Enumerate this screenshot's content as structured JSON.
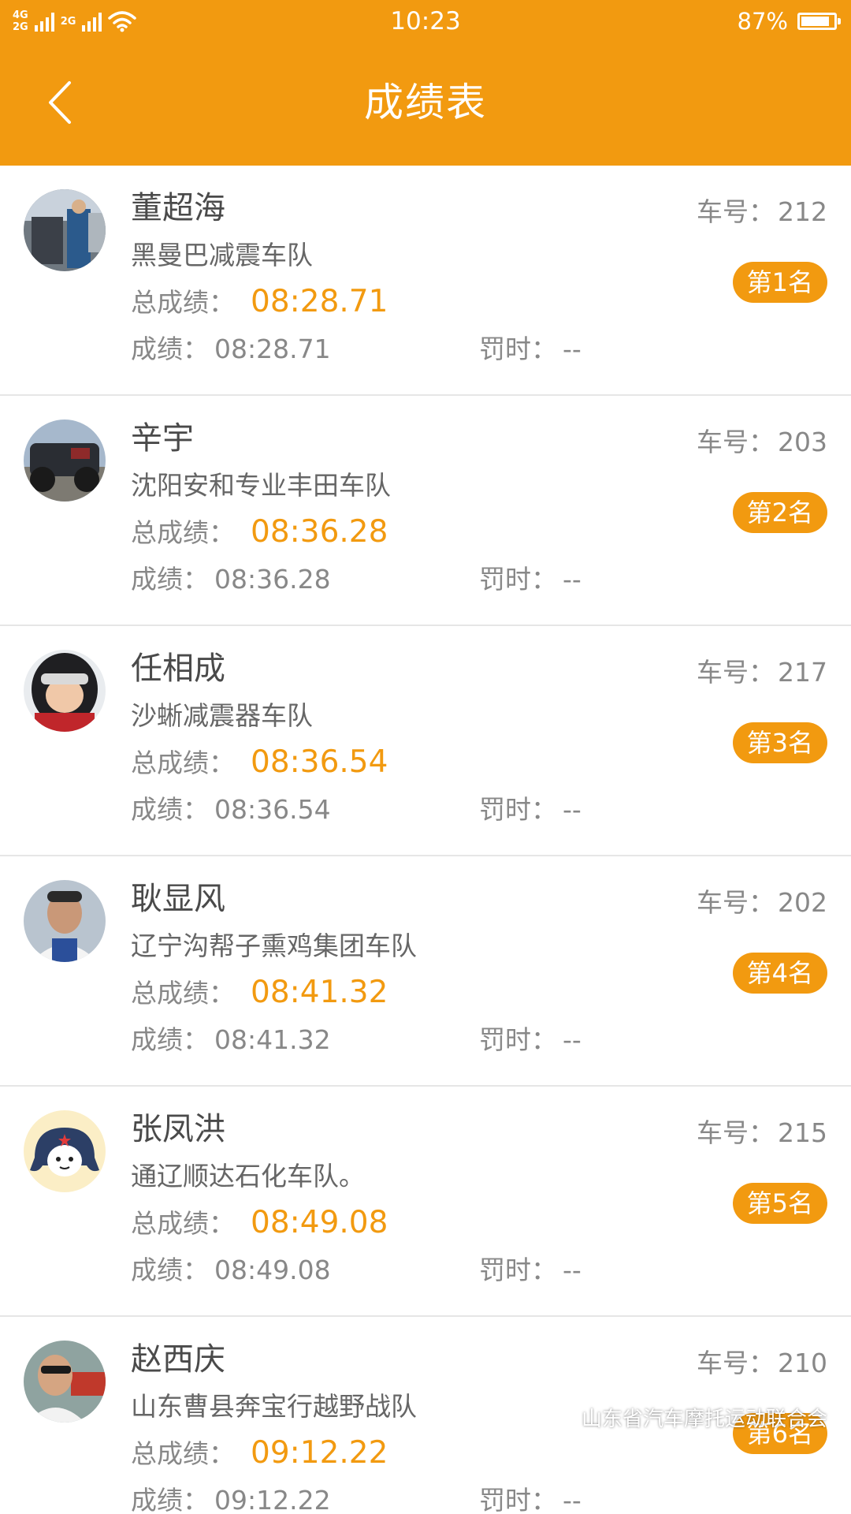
{
  "status_bar": {
    "network_top": "4G",
    "network_bottom": "2G",
    "network_extra": "2G",
    "time": "10:23",
    "battery": "87%",
    "battery_level": 0.87
  },
  "nav": {
    "title": "成绩表"
  },
  "labels": {
    "car_no": "车号：",
    "total": "总成绩：",
    "score": "成绩：",
    "penalty": "罚时："
  },
  "results": [
    {
      "name": "董超海",
      "team": "黑曼巴减震车队",
      "car_no": "212",
      "rank": "第1名",
      "total": "08:28.71",
      "score": "08:28.71",
      "penalty": "--",
      "avatar": "photo-avatar"
    },
    {
      "name": "辛宇",
      "team": "沈阳安和专业丰田车队",
      "car_no": "203",
      "rank": "第2名",
      "total": "08:36.28",
      "score": "08:36.28",
      "penalty": "--",
      "avatar": "photo-avatar"
    },
    {
      "name": "任相成",
      "team": "沙蜥减震器车队",
      "car_no": "217",
      "rank": "第3名",
      "total": "08:36.54",
      "score": "08:36.54",
      "penalty": "--",
      "avatar": "photo-avatar"
    },
    {
      "name": "耿显风",
      "team": "辽宁沟帮子熏鸡集团车队",
      "car_no": "202",
      "rank": "第4名",
      "total": "08:41.32",
      "score": "08:41.32",
      "penalty": "--",
      "avatar": "photo-avatar"
    },
    {
      "name": "张凤洪",
      "team": "通辽顺达石化车队。",
      "car_no": "215",
      "rank": "第5名",
      "total": "08:49.08",
      "score": "08:49.08",
      "penalty": "--",
      "avatar": "cartoon-avatar"
    },
    {
      "name": "赵西庆",
      "team": "山东曹县奔宝行越野战队",
      "car_no": "210",
      "rank": "第6名",
      "total": "09:12.22",
      "score": "09:12.22",
      "penalty": "--",
      "avatar": "photo-avatar"
    }
  ],
  "watermark": {
    "text": "山东省汽车摩托运动联合会",
    "icon": "wechat-icon"
  },
  "colors": {
    "accent": "#f29a10",
    "text_primary": "#4a4a4a",
    "text_secondary": "#888888",
    "divider": "#e6e6e6"
  }
}
